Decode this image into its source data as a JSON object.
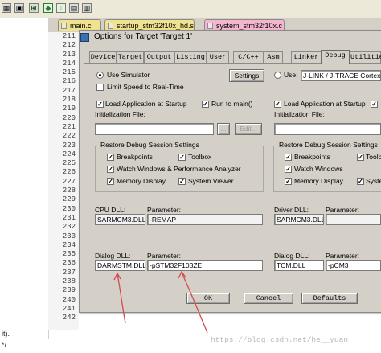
{
  "ide": {
    "file_tabs": [
      {
        "label": "main.c",
        "color": "#f0e28e"
      },
      {
        "label": "startup_stm32f10x_hd.s",
        "color": "#f0e28e"
      },
      {
        "label": "system_stm32f10x.c",
        "color": "#f4b6cf"
      }
    ],
    "line_numbers": [
      "211",
      "212",
      "213",
      "214",
      "215",
      "216",
      "217",
      "218",
      "219",
      "220",
      "221",
      "222",
      "223",
      "224",
      "225",
      "226",
      "227",
      "228",
      "229",
      "230",
      "231",
      "232",
      "233",
      "234",
      "235",
      "236",
      "237",
      "238",
      "239",
      "240",
      "241",
      "242"
    ],
    "bottom_left": "it).",
    "bottom_left2": "*/",
    "watermark": "https://blog.csdn.net/he__yuan"
  },
  "dialog": {
    "title": "Options for Target 'Target 1'",
    "tabs": [
      "Device",
      "Target",
      "Output",
      "Listing",
      "User",
      "C/C++",
      "Asm",
      "Linker",
      "Debug",
      "Utilities"
    ],
    "active_tab": "Debug",
    "left": {
      "use_simulator": "Use Simulator",
      "settings_btn": "Settings",
      "limit_speed": "Limit Speed to Real-Time",
      "load_app": "Load Application at Startup",
      "run_to_main": "Run to main()",
      "init_file_label": "Initialization File:",
      "browse_btn": "...",
      "edit_btn": "Edit...",
      "restore_group": "Restore Debug Session Settings",
      "breakpoints": "Breakpoints",
      "toolbox": "Toolbox",
      "watch_windows": "Watch Windows & Performance Analyzer",
      "memory_display": "Memory Display",
      "system_viewer": "System Viewer",
      "cpu_dll_label": "CPU DLL:",
      "cpu_param_label": "Parameter:",
      "cpu_dll": "SARMCM3.DLL",
      "cpu_param": "-REMAP",
      "dialog_dll_label": "Dialog DLL:",
      "dialog_param_label": "Parameter:",
      "dialog_dll": "DARMSTM.DLL",
      "dialog_param": "-pSTM32F103ZE"
    },
    "right": {
      "use": "Use:",
      "driver_select": "J-LINK / J-TRACE Cortex",
      "load_app": "Load Application at Startup",
      "run_to_main": "Run",
      "init_file_label": "Initialization File:",
      "restore_group": "Restore Debug Session Settings",
      "breakpoints": "Breakpoints",
      "toolbox": "Toolb",
      "watch_windows": "Watch Windows",
      "memory_display": "Memory Display",
      "system_viewer": "System",
      "driver_dll_label": "Driver DLL:",
      "driver_param_label": "Parameter:",
      "driver_dll": "SARMCM3.DLL",
      "driver_param": "",
      "dialog_dll_label": "Dialog DLL:",
      "dialog_param_label": "Parameter:",
      "dialog_dll": "TCM.DLL",
      "dialog_param": "-pCM3"
    },
    "footer": {
      "ok": "OK",
      "cancel": "Cancel",
      "defaults": "Defaults"
    }
  },
  "annotation_color": "#d4494b"
}
